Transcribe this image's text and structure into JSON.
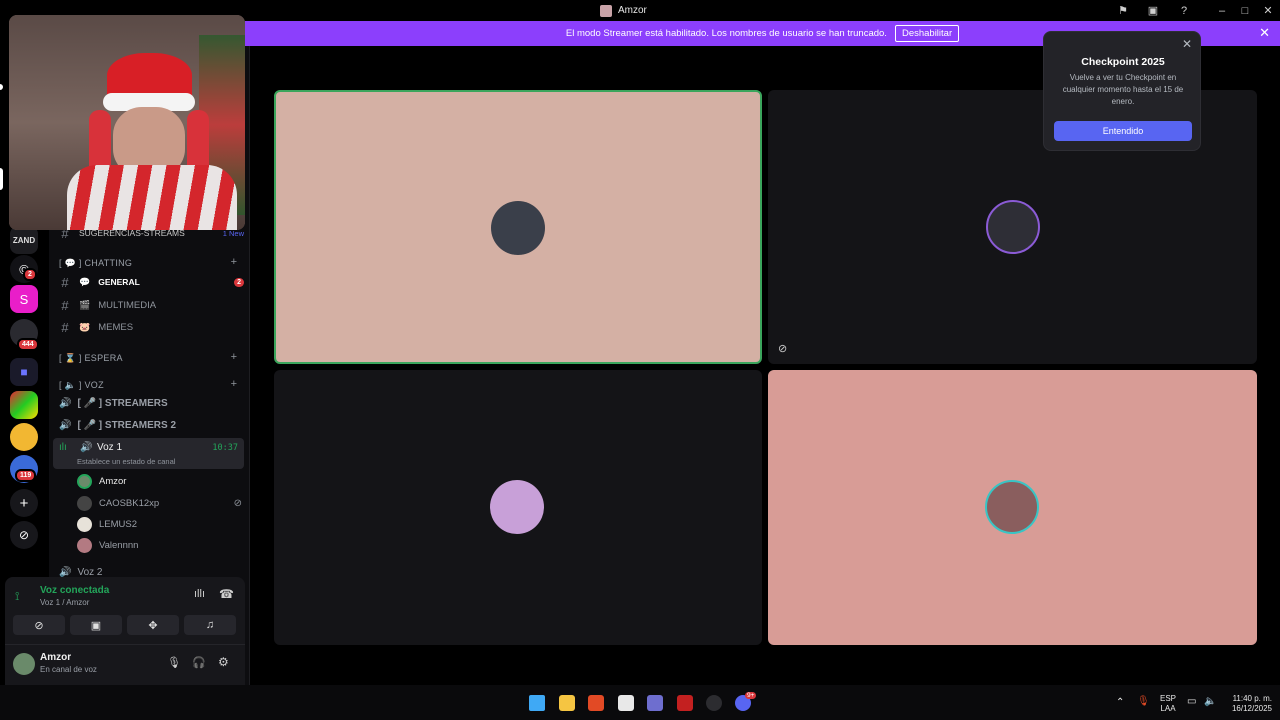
{
  "window": {
    "title": "Amzor"
  },
  "banner": {
    "text": "El modo Streamer está habilitado. Los nombres de usuario se han truncado.",
    "button": "Deshabilitar"
  },
  "popover": {
    "title": "Checkpoint 2025",
    "body": "Vuelve a ver tu Checkpoint en cualquier momento hasta el 15 de enero.",
    "button": "Entendido"
  },
  "rail": {
    "badges": [
      "2",
      "444",
      "119"
    ],
    "server_s_letter": "S"
  },
  "sidebar": {
    "top_channel": "SUGERENCIAS-STREAMS",
    "top_channel_badge": "1 New",
    "categories": {
      "chatting": "[ 💬 ] CHATTING",
      "espera": "[ ⌛ ] ESPERA",
      "voz": "[ 🔈 ] VOZ"
    },
    "text_channels": [
      {
        "name": "GENERAL",
        "emoji": "💬",
        "badge": "2"
      },
      {
        "name": "MULTIMEDIA",
        "emoji": "🎬",
        "badge": ""
      },
      {
        "name": "MEMES",
        "emoji": "🐷",
        "badge": ""
      }
    ],
    "voice_channels": [
      {
        "name": "[ 🎤 ] STREAMERS"
      },
      {
        "name": "[ 🎤 ] STREAMERS 2"
      }
    ],
    "active_voice": {
      "name": "Voz 1",
      "timer": "10:37",
      "status": "Establece un estado de canal"
    },
    "members": [
      "Amzor",
      "CAOSBK12xp",
      "LEMUS2",
      "Valennnn"
    ],
    "next_voice": "Voz 2"
  },
  "voice_panel": {
    "status": "Voz conectada",
    "location": "Voz 1 / Amzor"
  },
  "user": {
    "name": "Amzor",
    "status": "En canal de voz"
  },
  "taskbar": {
    "lang_top": "ESP",
    "lang_bottom": "LAA",
    "time": "11:40 p. m.",
    "date": "16/12/2025",
    "discord_badge": "9+"
  },
  "colors": {
    "accent": "#5865f2",
    "streamer_banner": "#8c3ffc",
    "voice_green": "#23a55a",
    "tile_pink_1": "#d4b0a4",
    "tile_pink_2": "#d89c96",
    "tile_dark": "#141417"
  }
}
